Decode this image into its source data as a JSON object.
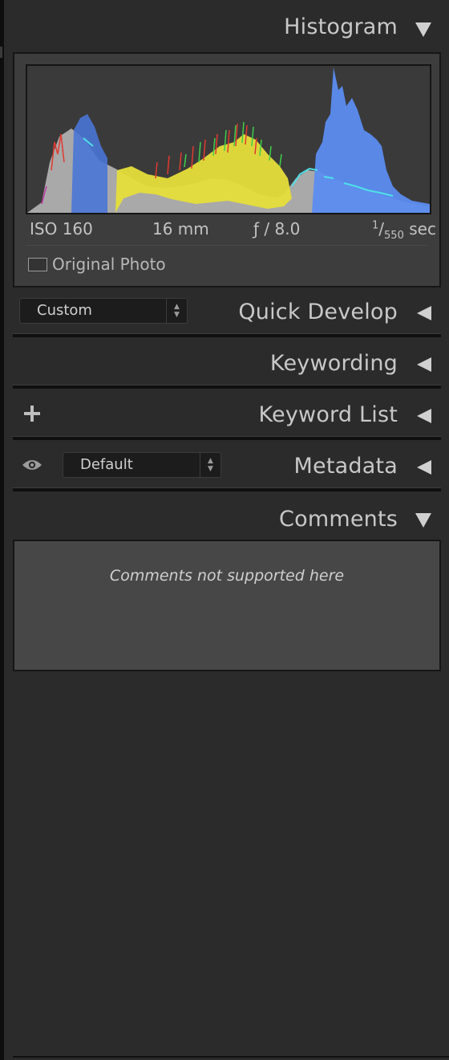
{
  "panels": {
    "histogram": {
      "title": "Histogram",
      "state": "expanded"
    },
    "quick_develop": {
      "title": "Quick Develop",
      "state": "collapsed",
      "preset_value": "Custom"
    },
    "keywording": {
      "title": "Keywording",
      "state": "collapsed"
    },
    "keyword_list": {
      "title": "Keyword List",
      "state": "collapsed"
    },
    "metadata": {
      "title": "Metadata",
      "state": "collapsed",
      "preset_value": "Default"
    },
    "comments": {
      "title": "Comments",
      "state": "expanded",
      "message": "Comments not supported here"
    }
  },
  "exif": {
    "iso": "ISO 160",
    "focal_length": "16 mm",
    "aperture": "ƒ / 8.0",
    "shutter_numerator": "1",
    "shutter_denominator": "550",
    "shutter_unit": "sec"
  },
  "original_photo": {
    "label": "Original Photo",
    "checked": false
  },
  "icons": {
    "collapse": "triangle-down-icon",
    "expand": "triangle-left-icon",
    "add": "plus-icon",
    "visibility": "eye-icon",
    "stepper": "up-down-arrows-icon"
  },
  "colors": {
    "panel_bg": "#2b2b2b",
    "histogram_luminance": "#a8a8a8",
    "histogram_blue": "#5b8cf0",
    "histogram_yellow": "#e6de3a",
    "histogram_red": "#e03a2f",
    "histogram_green": "#3fcf4a",
    "histogram_cyan": "#4fe0e8"
  }
}
